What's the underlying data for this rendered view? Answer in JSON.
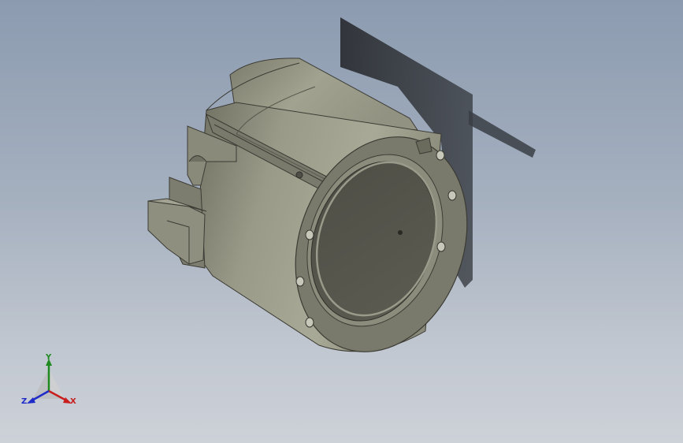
{
  "viewport": {
    "background_top": "#8c9bb0",
    "background_bottom": "#cdd1d8",
    "model_color": "#8e8e7e"
  },
  "triad": {
    "x_label": "X",
    "y_label": "Y",
    "z_label": "Z",
    "x_color": "#c81e1e",
    "y_color": "#1f8a1f",
    "z_color": "#1e2bc8"
  }
}
